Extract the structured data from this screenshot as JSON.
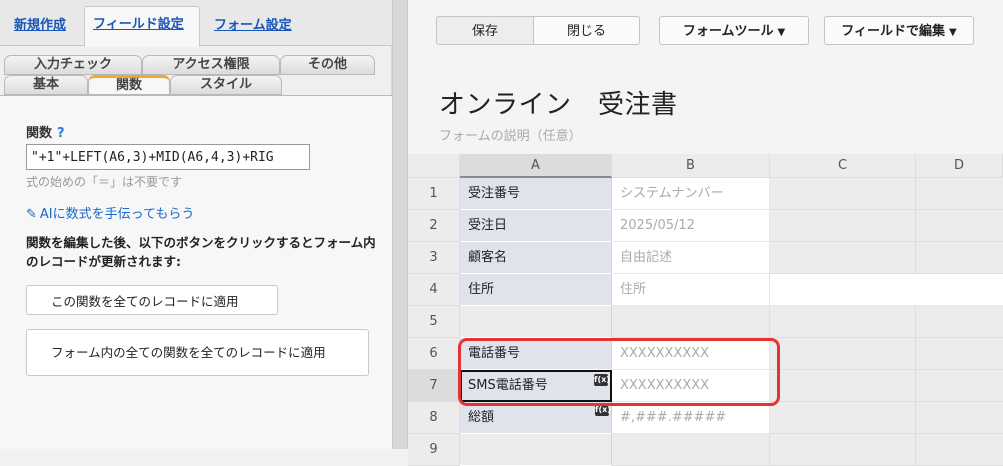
{
  "left": {
    "top_tabs": [
      "新規作成",
      "フィールド設定",
      "フォーム設定"
    ],
    "sub_tabs_row1": [
      "入力チェック",
      "アクセス権限",
      "その他"
    ],
    "sub_tabs_row2": [
      "基本",
      "関数",
      "スタイル"
    ],
    "func_label": "関数",
    "func_help": "?",
    "func_value": "\"+1\"+LEFT(A6,3)+MID(A6,4,3)+RIG",
    "func_note": "式の始めの「＝」は不要です",
    "ai_link": "AIに数式を手伝ってもらう",
    "desc": "関数を編集した後、以下のボタンをクリックするとフォーム内のレコードが更新されます:",
    "apply_one": "この関数を全てのレコードに適用",
    "apply_all": "フォーム内の全ての関数を全てのレコードに適用"
  },
  "toolbar": {
    "save": "保存",
    "close": "閉じる",
    "form_tool": "フォームツール",
    "field_edit": "フィールドで編集"
  },
  "form": {
    "title": "オンライン　受注書",
    "description": "フォームの説明（任意）"
  },
  "grid": {
    "columns": [
      "A",
      "B",
      "C",
      "D"
    ],
    "rows": [
      {
        "n": "1",
        "a": "受注番号",
        "b": "システムナンバー"
      },
      {
        "n": "2",
        "a": "受注日",
        "b": "2025/05/12"
      },
      {
        "n": "3",
        "a": "顧客名",
        "b": "自由記述"
      },
      {
        "n": "4",
        "a": "住所",
        "b": "住所"
      },
      {
        "n": "5",
        "a": "",
        "b": ""
      },
      {
        "n": "6",
        "a": "電話番号",
        "b": "XXXXXXXXXX"
      },
      {
        "n": "7",
        "a": "SMS電話番号",
        "b": "XXXXXXXXXX"
      },
      {
        "n": "8",
        "a": "総額",
        "b": "#,###.#####"
      },
      {
        "n": "9",
        "a": "",
        "b": ""
      }
    ],
    "fx_label": "f(x)"
  }
}
